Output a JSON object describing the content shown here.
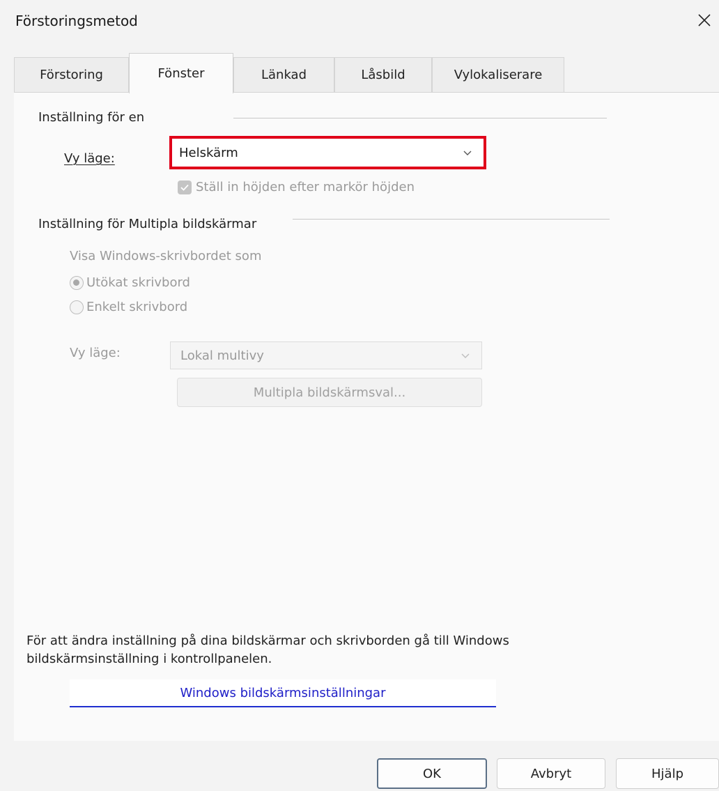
{
  "window": {
    "title": "Förstoringsmetod"
  },
  "tabs": [
    {
      "label": "Förstoring"
    },
    {
      "label": "Fönster"
    },
    {
      "label": "Länkad"
    },
    {
      "label": "Låsbild"
    },
    {
      "label": "Vylokaliserare"
    }
  ],
  "single_monitor": {
    "section_title": "Inställning för en",
    "view_mode_label": "Vy läge:",
    "view_mode_value": "Helskärm",
    "cursor_height_checkbox": {
      "label": "Ställ in höjden efter markör höjden",
      "checked": true
    }
  },
  "multi_monitor": {
    "section_title": "Inställning för Multipla bildskärmar",
    "desktop_as_label": "Visa Windows-skrivbordet som",
    "options": [
      {
        "label": "Utökat skrivbord",
        "checked": true
      },
      {
        "label": "Enkelt skrivbord",
        "checked": false
      }
    ],
    "view_mode_label": "Vy läge:",
    "view_mode_value": "Lokal multivy",
    "options_button": "Multipla bildskärmsval..."
  },
  "info": {
    "line1": "För att ändra inställning på dina bildskärmar och skrivborden gå till Windows",
    "line2": "bildskärmsinställning i kontrollpanelen.",
    "link": "Windows bildskärmsinställningar"
  },
  "footer": {
    "ok": "OK",
    "cancel": "Avbryt",
    "help": "Hjälp"
  },
  "colors": {
    "highlight": "#e0001a",
    "link": "#2020c8"
  }
}
